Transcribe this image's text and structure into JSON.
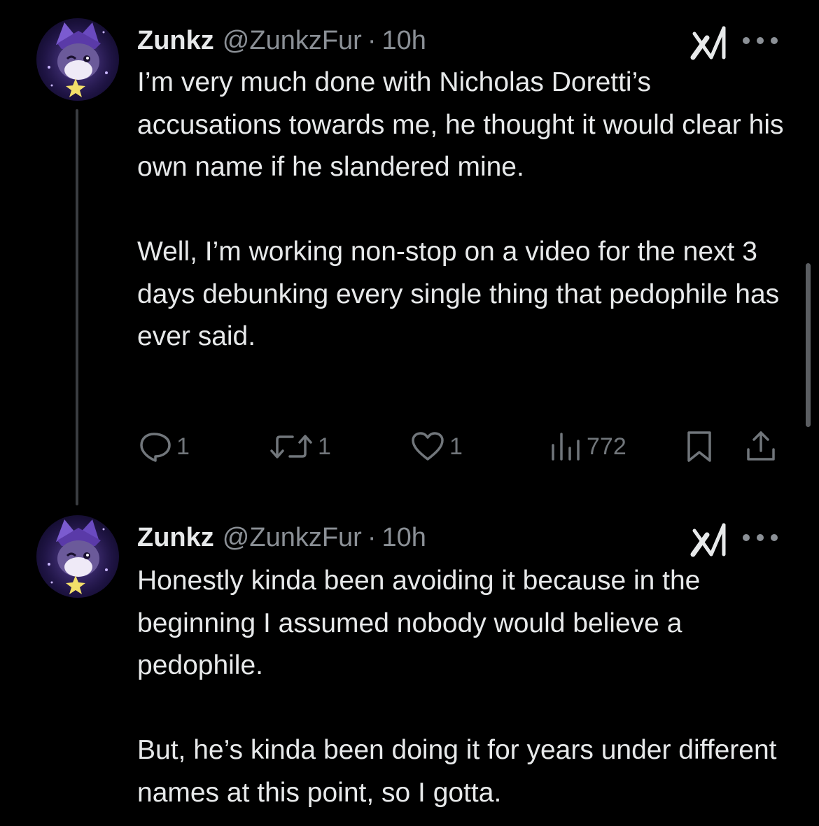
{
  "colors": {
    "background": "#000000",
    "text_primary": "#e7e9ea",
    "text_secondary": "#8b9096",
    "icon": "#71767b",
    "thread_line": "#3a3d41"
  },
  "tweets": [
    {
      "author": {
        "name": "Zunkz",
        "handle": "@ZunkzFur",
        "avatar_icon": "furry-character-avatar"
      },
      "separator": "·",
      "time": "10h",
      "badge_icon": "grok-x-icon",
      "more_icon": "more-options-icon",
      "paragraphs": [
        "I’m very much done with Nicholas Doretti’s accusations towards me, he thought it would clear his own name if he slandered mine.",
        "Well, I’m working non-stop on a video for the next 3 days debunking every single thing that pedophile has ever said."
      ],
      "actions": {
        "replies": "1",
        "retweets": "1",
        "likes": "1",
        "views": "772"
      }
    },
    {
      "author": {
        "name": "Zunkz",
        "handle": "@ZunkzFur",
        "avatar_icon": "furry-character-avatar"
      },
      "separator": "·",
      "time": "10h",
      "badge_icon": "grok-x-icon",
      "more_icon": "more-options-icon",
      "paragraphs": [
        "Honestly kinda been avoiding it because in the beginning I assumed nobody would believe a pedophile.",
        "But, he’s kinda been doing it for years under different names at this point, so I gotta."
      ]
    }
  ]
}
